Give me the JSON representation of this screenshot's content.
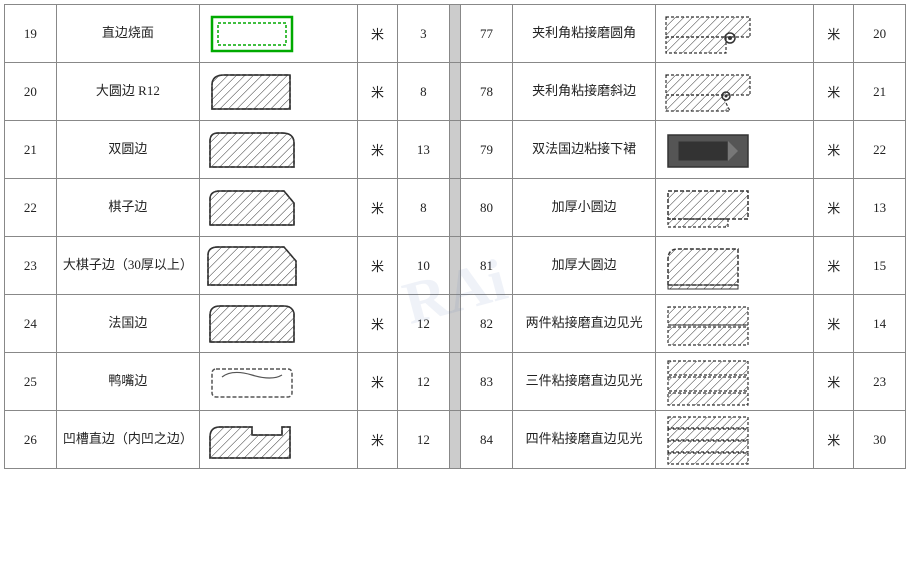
{
  "watermark": "RAi",
  "table": {
    "left": [
      {
        "num": 19,
        "name": "直边烧面",
        "unit": "米",
        "price": 3,
        "img": "burn"
      },
      {
        "num": 20,
        "name": "大圆边 R12",
        "unit": "米",
        "price": 8,
        "img": "big-round"
      },
      {
        "num": 21,
        "name": "双圆边",
        "unit": "米",
        "price": 13,
        "img": "double-round"
      },
      {
        "num": 22,
        "name": "棋子边",
        "unit": "米",
        "price": 8,
        "img": "chess"
      },
      {
        "num": 23,
        "name": "大棋子边（30厚以上）",
        "unit": "米",
        "price": 10,
        "img": "big-chess"
      },
      {
        "num": 24,
        "name": "法国边",
        "unit": "米",
        "price": 12,
        "img": "france"
      },
      {
        "num": 25,
        "name": "鸭嘴边",
        "unit": "米",
        "price": 12,
        "img": "duck"
      },
      {
        "num": 26,
        "name": "凹槽直边（内凹之边）",
        "unit": "米",
        "price": 12,
        "img": "groove"
      }
    ],
    "right": [
      {
        "num": 77,
        "name": "夹利角粘接磨圆角",
        "unit": "米",
        "price": 20,
        "img": "clip-round"
      },
      {
        "num": 78,
        "name": "夹利角粘接磨斜边",
        "unit": "米",
        "price": 21,
        "img": "clip-bevel"
      },
      {
        "num": 79,
        "name": "双法国边粘接下裙",
        "unit": "米",
        "price": 22,
        "img": "double-france-skirt"
      },
      {
        "num": 80,
        "name": "加厚小圆边",
        "unit": "米",
        "price": 13,
        "img": "thick-small-round"
      },
      {
        "num": 81,
        "name": "加厚大圆边",
        "unit": "米",
        "price": 15,
        "img": "thick-big-round"
      },
      {
        "num": 82,
        "name": "两件粘接磨直边见光",
        "unit": "米",
        "price": 14,
        "img": "two-glue"
      },
      {
        "num": 83,
        "name": "三件粘接磨直边见光",
        "unit": "米",
        "price": 23,
        "img": "three-glue"
      },
      {
        "num": 84,
        "name": "四件粘接磨直边见光",
        "unit": "米",
        "price": 30,
        "img": "four-glue"
      }
    ]
  }
}
